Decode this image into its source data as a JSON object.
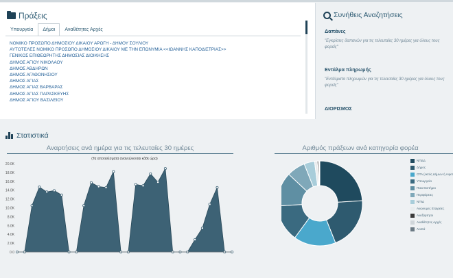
{
  "praxeis": {
    "title": "Πράξεις",
    "tabs": [
      "Υπουργεία",
      "Δήμοι",
      "Αναθέτητες Αρχές"
    ],
    "active_tab": 1,
    "items": [
      "ΝΟΜΙΚΟ ΠΡΟΣΩΠΟ ΔΗΜΟΣΙΟΥ ΔΙΚΑΙΟΥ ΑΡΩΓΗ - ΔΗΜΟΥ ΣΟΥΛΙΟΥ",
      "ΑΥΤΟΤΕΛΕΣ ΝΟΜΙΚΟ ΠΡΟΣΩΠΟ ΔΗΜΟΣΙΟΥ ΔΙΚΑΙΟΥ ΜΕ ΤΗΝ ΕΠΩΝΥΜΙΑ <<ΙΩΑΝΝΗΣ ΚΑΠΟΔΙΣΤΡΙΑΣ>>",
      "ΓΕΝΙΚΟΣ ΕΠΙΘΕΩΡΗΤΗΣ ΔΗΜΟΣΙΑΣ ΔΙΟΙΚΗΣΗΣ",
      "ΔΗΜΟΣ ΑΓΙΟΥ ΝΙΚΟΛΑΟΥ",
      "ΔΗΜΟΣ ΑΒΔΗΡΩΝ",
      "ΔΗΜΟΣ ΑΓΑΘΟΝΗΣΙΟΥ",
      "ΔΗΜΟΣ ΑΓΙΑΣ",
      "ΔΗΜΟΣ ΑΓΙΑΣ ΒΑΡΒΑΡΑΣ",
      "ΔΗΜΟΣ ΑΓΙΑΣ ΠΑΡΑΣΚΕΥΗΣ",
      "ΔΗΜΟΣ ΑΓΙΟΥ ΒΑΣΙΛΕΙΟΥ"
    ]
  },
  "searches": {
    "title": "Συνήθεις Αναζητήσεις",
    "sections": [
      {
        "title": "Δαπάνες",
        "desc": "\"Εγκρίσεις δαπανών για τις τελευταίες 30 ημέρες για όλους τους φορείς\""
      },
      {
        "title": "Εντάλμα πληρωμής",
        "desc": "\"Εντάλματα πληρωμών για τις τελευταίες 30 ημέρες για όλους τους φορείς\""
      },
      {
        "title": "ΔΙΟΡΙΣΜΟΣ",
        "desc": ""
      }
    ]
  },
  "stats": {
    "title": "Στατιστικά"
  },
  "chart_data": [
    {
      "type": "area",
      "title": "Αναρτήσεις ανά ημέρα για τις τελευταίες 30 ημέρες",
      "subtitle": "(Τα αποτελέσματα ανανεώνονται κάθε ώρα)",
      "ylim": [
        0,
        20000
      ],
      "ytick_labels": [
        "0.0",
        "2.0K",
        "4.0K",
        "6.0K",
        "8.0K",
        "10.0K",
        "12.0K",
        "14.0K",
        "16.0K",
        "18.0K",
        "20.0K"
      ],
      "x": [
        1,
        2,
        3,
        4,
        5,
        6,
        7,
        8,
        9,
        10,
        11,
        12,
        13,
        14,
        15,
        16,
        17,
        18,
        19,
        20,
        21,
        22,
        23,
        24,
        25,
        26,
        27,
        28,
        29,
        30
      ],
      "values": [
        0,
        0,
        10500,
        14700,
        13600,
        13900,
        12900,
        0,
        0,
        10500,
        15700,
        14800,
        14600,
        18200,
        0,
        0,
        15300,
        15000,
        17700,
        15800,
        18900,
        0,
        0,
        0,
        2800,
        5400,
        10800,
        14600,
        0,
        0
      ],
      "color": "#3d6275"
    },
    {
      "type": "pie",
      "title": "Αριθμός πράξεων ανά κατηγορία φορέα",
      "categories": [
        "ΝΠΔΔ",
        "Δήμος",
        "ΟΤΑ (εκτός Δήμων ή Αιρετή Περιφέρεια)",
        "Υπουργεία",
        "Πανεπιστήμιο",
        "Περιφέρειες",
        "ΝΠΙΔ",
        "Ανώνυμες Εταιρείες",
        "Ανεξάρτητοι",
        "Αναθέτητες Αρχές",
        "Λοιπά"
      ],
      "values": [
        24,
        20,
        16,
        14,
        13,
        7,
        4,
        1,
        0.5,
        0.3,
        0.2
      ],
      "colors": [
        "#1f4a5e",
        "#2e5a6f",
        "#4aa8cc",
        "#3a6a80",
        "#5f8fa3",
        "#7fa8b9",
        "#a8cdda",
        "#e8ecee",
        "#3a3a3a",
        "#d0d6da",
        "#6b7a84"
      ]
    }
  ]
}
